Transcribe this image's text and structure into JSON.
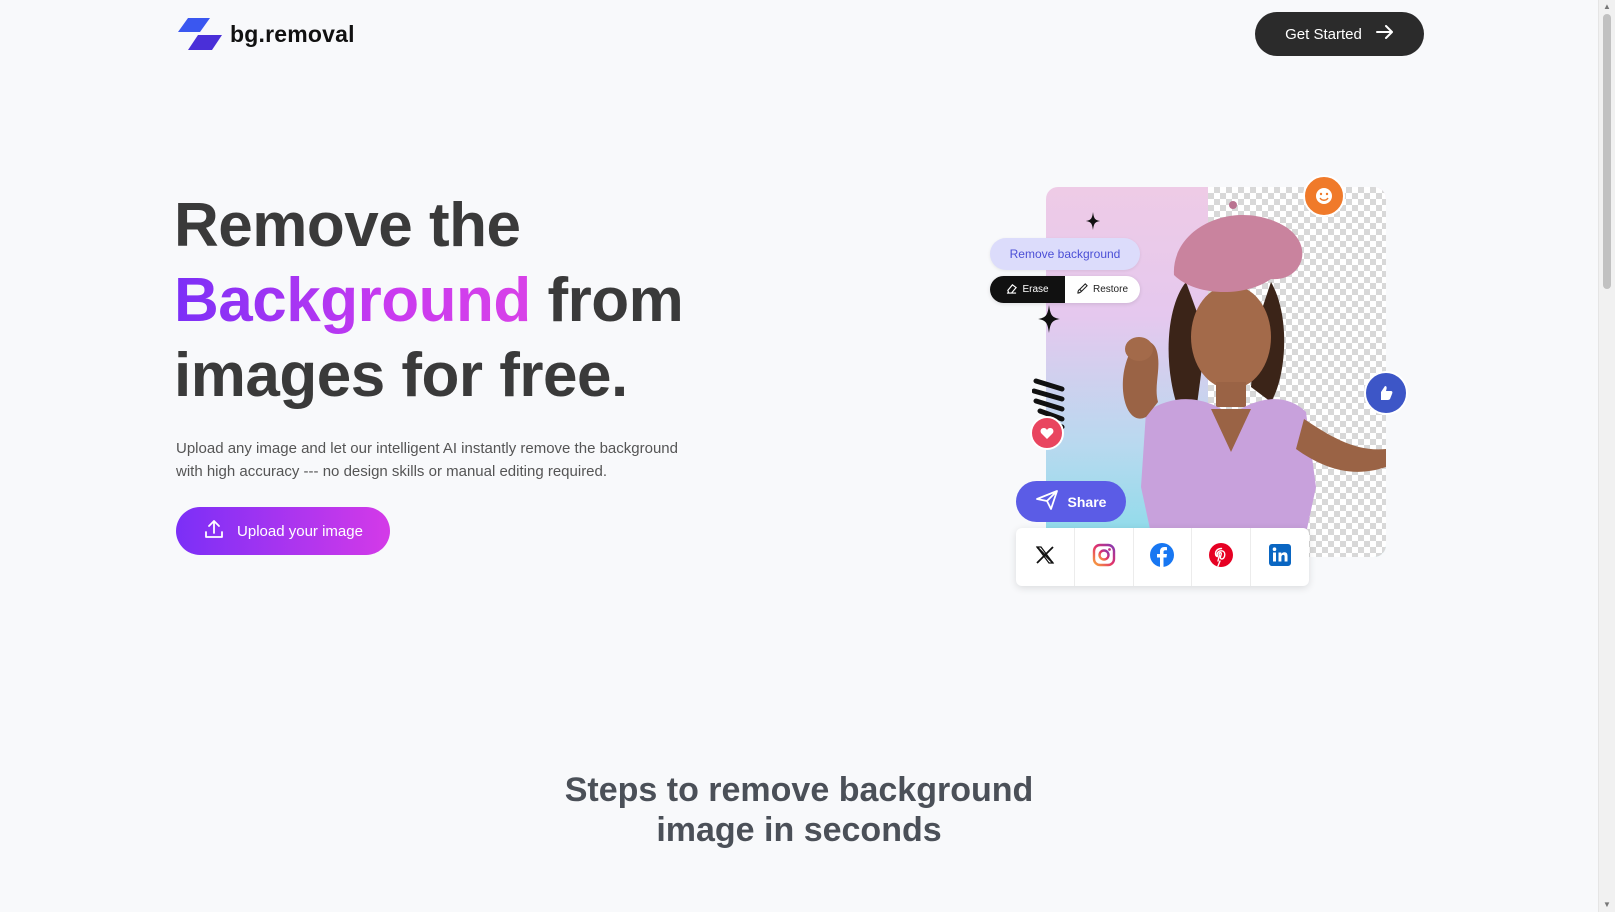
{
  "brand": {
    "name": "bg.removal"
  },
  "header": {
    "cta_label": "Get Started"
  },
  "hero": {
    "title_line1": "Remove the",
    "title_accent": "Background",
    "title_line2_rest": " from",
    "title_line3": "images for free.",
    "subtitle": "Upload any image and let our intelligent AI instantly remove the background with high accuracy --- no design skills or manual editing required.",
    "upload_label": "Upload your image"
  },
  "illustration": {
    "remove_bg_label": "Remove background",
    "erase_label": "Erase",
    "restore_label": "Restore",
    "share_label": "Share",
    "social_icons": [
      "x-icon",
      "instagram-icon",
      "facebook-icon",
      "pinterest-icon",
      "linkedin-icon"
    ]
  },
  "steps": {
    "title_line1": "Steps to remove background",
    "title_line2": "image in seconds"
  },
  "colors": {
    "accent_purple": "#7b2ff7",
    "accent_pink": "#d43ae8",
    "dark": "#2b2b2b",
    "share_blue": "#5b5ce6"
  }
}
